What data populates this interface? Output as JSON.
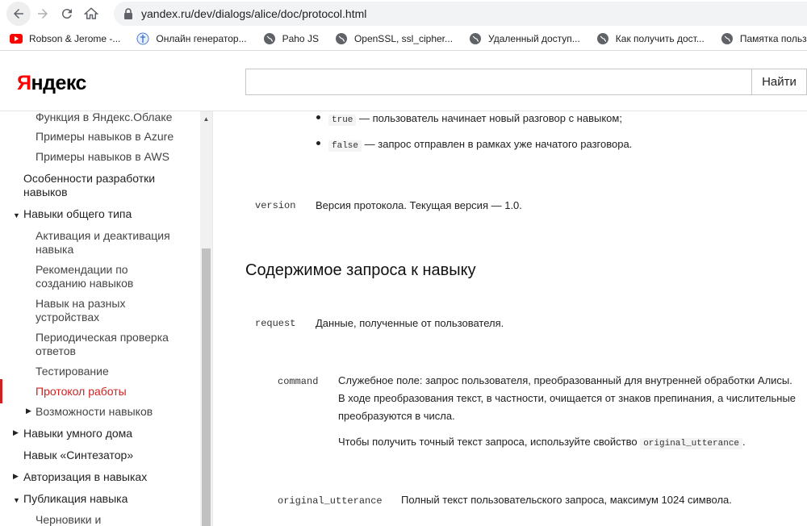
{
  "browser": {
    "url": "yandex.ru/dev/dialogs/alice/doc/protocol.html",
    "bookmarks": [
      {
        "label": "Robson & Jerome -...",
        "icon": "youtube-icon"
      },
      {
        "label": "Онлайн генератор...",
        "icon": "generator-icon"
      },
      {
        "label": "Paho JS",
        "icon": "globe-icon"
      },
      {
        "label": "OpenSSL, ssl_cipher...",
        "icon": "globe-icon"
      },
      {
        "label": "Удаленный доступ...",
        "icon": "globe-icon"
      },
      {
        "label": "Как получить дост...",
        "icon": "globe-icon"
      },
      {
        "label": "Памятка пользова...",
        "icon": "globe-icon"
      }
    ]
  },
  "header": {
    "logo_first": "Я",
    "logo_rest": "ндекс",
    "search_value": "",
    "search_button": "Найти"
  },
  "sidebar": {
    "items": [
      {
        "label": "Функция в Яндекс.Облаке"
      },
      {
        "label": "Примеры навыков в Azure"
      },
      {
        "label": "Примеры навыков в AWS"
      },
      {
        "label": "Особенности разработки навыков"
      },
      {
        "label": "Навыки общего типа"
      },
      {
        "label": "Активация и деактивация навыка"
      },
      {
        "label": "Рекомендации по созданию навыков"
      },
      {
        "label": "Навык на разных устройствах"
      },
      {
        "label": "Периодическая проверка ответов"
      },
      {
        "label": "Тестирование"
      },
      {
        "label": "Протокол работы"
      },
      {
        "label": "Возможности навыков"
      },
      {
        "label": "Навыки умного дома"
      },
      {
        "label": "Навык «Синтезатор»"
      },
      {
        "label": "Авторизация в навыках"
      },
      {
        "label": "Публикация навыка"
      },
      {
        "label": "Черновики и"
      }
    ]
  },
  "content": {
    "bullets": [
      {
        "code": "true",
        "text": "— пользователь начинает новый разговор с навыком;"
      },
      {
        "code": "false",
        "text": "— запрос отправлен в рамках уже начатого разговора."
      }
    ],
    "version": {
      "key": "version",
      "desc": "Версия протокола. Текущая версия — 1.0."
    },
    "section_title": "Содержимое запроса к навыку",
    "request": {
      "key": "request",
      "desc": "Данные, полученные от пользователя."
    },
    "command": {
      "key": "command",
      "line1": "Служебное поле: запрос пользователя, преобразованный для внутренней обработки Алисы.",
      "line2": "В ходе преобразования текст, в частности, очищается от знаков препинания, а числительные",
      "line3": "преобразуются в числа.",
      "hint_text": "Чтобы получить точный текст запроса, используйте свойство",
      "hint_code": "original_utterance",
      "hint_end": "."
    },
    "original_utterance": {
      "key": "original_utterance",
      "desc": "Полный текст пользовательского запроса, максимум 1024 символа."
    }
  }
}
